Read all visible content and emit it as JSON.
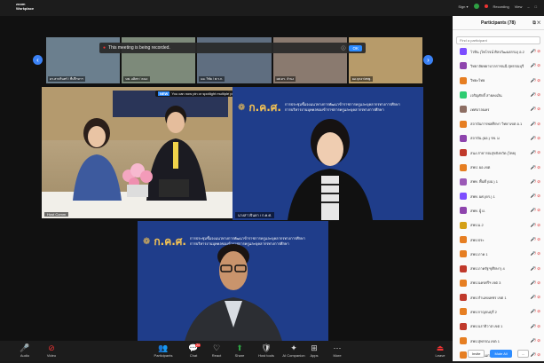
{
  "app": {
    "logo_line1": "zoom",
    "logo_line2": "Workplace"
  },
  "topbar": {
    "sign_label": "Sign ▾",
    "recording_label": "Recording",
    "view_label": "View"
  },
  "recording_notice": {
    "text": "This meeting is being recorded.",
    "ok_label": "OK"
  },
  "spotlight_notice": {
    "tag": "NEW",
    "text": "You can now pin or spotlight multiple people"
  },
  "thumbnails": [
    {
      "name": "ดร.สาครินทร์ / ที่ปรึกษาฯ"
    },
    {
      "name": "นพ. อดิศร / คณะ"
    },
    {
      "name": "ผอ. วิชัย / พ.ร.ก."
    },
    {
      "name": "ผศ.ดร. จำนง"
    },
    {
      "name": "ผอ.บุหงา/สพฐ."
    }
  ],
  "banner": {
    "org": "ก.ค.ศ.",
    "line1": "การประชุมชี้แจงแนวทางการพัฒนาข้าราชการครูและบุคลากรทางการศึกษา",
    "line2": "การบริหารงานบุคคลของข้าราชการครูและบุคลากรทางการศึกษา"
  },
  "videos": [
    {
      "label": "Host Comm"
    },
    {
      "label": "นางสาวจินดา / ก.ค.ศ."
    },
    {
      "label": "วีรพงษ์ / ก.ค.ศ."
    }
  ],
  "toolbar": [
    {
      "icon": "mic-icon",
      "glyph": "🎤",
      "label": "Audio"
    },
    {
      "icon": "video-off-icon",
      "glyph": "⊘",
      "label": "Video"
    },
    {
      "icon": "participants-icon",
      "glyph": "👥",
      "label": "Participants",
      "count": "78"
    },
    {
      "icon": "chat-icon",
      "glyph": "💬",
      "label": "Chat",
      "badge": "24"
    },
    {
      "icon": "react-icon",
      "glyph": "♡",
      "label": "React"
    },
    {
      "icon": "share-icon",
      "glyph": "⬆",
      "label": "Share"
    },
    {
      "icon": "host-tools-icon",
      "glyph": "🛡",
      "label": "Host tools"
    },
    {
      "icon": "ai-companion-icon",
      "glyph": "✦",
      "label": "AI Companion"
    },
    {
      "icon": "apps-icon",
      "glyph": "⊞",
      "label": "Apps"
    },
    {
      "icon": "more-icon",
      "glyph": "⋯",
      "label": "More"
    },
    {
      "icon": "leave-icon",
      "glyph": "⏏",
      "label": "Leave"
    }
  ],
  "panel": {
    "title": "Participants (78)",
    "search_placeholder": "Find a participant",
    "invite_label": "Invite",
    "mute_all_label": "Mute All",
    "more_label": "...",
    "participants": [
      {
        "name": "ไวทิน (ไพโรจน์ ศิลปวัฒนธรรม) อ.2",
        "color": "#7c4dff"
      },
      {
        "name": "วิทยาลัยพยาบาลราชนนี สุพรรณบุรี",
        "color": "#8e44ad"
      },
      {
        "name": "วิทยะไทย",
        "color": "#e67e22"
      },
      {
        "name": "เจริญศักดิ์ สายคงเงิน",
        "color": "#2ecc71"
      },
      {
        "name": "เทศบาลนคร",
        "color": "#8d6e63"
      },
      {
        "name": "สถาบันการพลศึกษา วิทยาเขต อ.1",
        "color": "#e67e22"
      },
      {
        "name": "สถาบัน (ผอ.) รพ. ม",
        "color": "#8e44ad"
      },
      {
        "name": "สนง.สาธารณสุขจังหวัด (ไทย)",
        "color": "#c0392b"
      },
      {
        "name": "สพป. ผอ.เขต",
        "color": "#e67e22"
      },
      {
        "name": "สพท. พื้นที่ (ผอ.) 1",
        "color": "#9b59b6"
      },
      {
        "name": "สพท. ผศ.(ดร.) 1",
        "color": "#7c4dff"
      },
      {
        "name": "สพท. ผู้ ผ.",
        "color": "#8e44ad"
      },
      {
        "name": "สพป.ม.2",
        "color": "#d4a017"
      },
      {
        "name": "สพป.ประ",
        "color": "#e67e22"
      },
      {
        "name": "สพป.ภาค 1",
        "color": "#e67e22"
      },
      {
        "name": "สพป.ภาครัฐฯ(ศึกษา) 4",
        "color": "#c0392b"
      },
      {
        "name": "สพป.นครศรีฯ เขต 3",
        "color": "#e67e22"
      },
      {
        "name": "สพป.กำแพงเพชร เขต 1",
        "color": "#c0392b"
      },
      {
        "name": "สพป.กาญจนบุรี 2",
        "color": "#e67e22"
      },
      {
        "name": "สพป.นราธิวาส เขต 1",
        "color": "#c0392b"
      },
      {
        "name": "สพป.สุพรรณ เขต 1",
        "color": "#e67e22"
      },
      {
        "name": "สพป.ขอนแก่น เขต 2",
        "color": "#e67e22"
      }
    ]
  }
}
